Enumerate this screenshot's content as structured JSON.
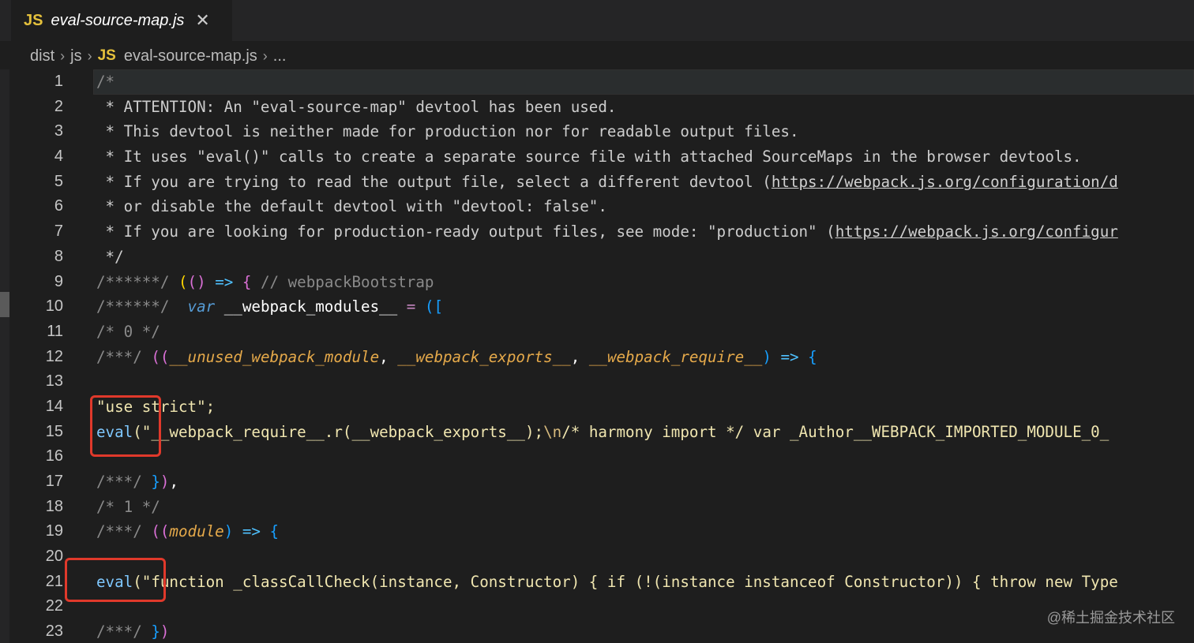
{
  "tab": {
    "badge": "JS",
    "title": "eval-source-map.js",
    "close": "✕"
  },
  "breadcrumb": {
    "items": [
      "dist",
      "js"
    ],
    "badge": "JS",
    "file": "eval-source-map.js",
    "tail": "..."
  },
  "line_numbers": [
    "1",
    "2",
    "3",
    "4",
    "5",
    "6",
    "7",
    "8",
    "9",
    "10",
    "11",
    "12",
    "13",
    "14",
    "15",
    "16",
    "17",
    "18",
    "19",
    "20",
    "21",
    "22",
    "23"
  ],
  "code": {
    "l1": "/*",
    "l2": " * ATTENTION: An \"eval-source-map\" devtool has been used.",
    "l3": " * This devtool is neither made for production nor for readable output files.",
    "l4": " * It uses \"eval()\" calls to create a separate source file with attached SourceMaps in the browser devtools.",
    "l5_a": " * If you are trying to read the output file, select a different devtool (",
    "l5_link": "https://webpack.js.org/configuration/d",
    "l6": " * or disable the default devtool with \"devtool: false\".",
    "l7_a": " * If you are looking for production-ready output files, see mode: \"production\" (",
    "l7_link": "https://webpack.js.org/configur",
    "l8": " */",
    "l9_comment": "/******/ ",
    "l9_p1": "(",
    "l9_p2": "()",
    "l9_arrow": " => ",
    "l9_brace": "{",
    "l9_tail": " // webpackBootstrap",
    "l10_comment": "/******/ ",
    "l10_kw": " var",
    "l10_name": " __webpack_modules__ ",
    "l10_eq": "=",
    "l10_bracket": " ([",
    "l11": "/* 0 */",
    "l12_comment": "/***/ ",
    "l12_p": "((",
    "l12_a1": "__unused_webpack_module",
    "l12_c1": ", ",
    "l12_a2": "__webpack_exports__",
    "l12_c2": ", ",
    "l12_a3": "__webpack_require__",
    "l12_close": ")",
    "l12_arrow": " => ",
    "l12_brace": "{",
    "l14": "\"use strict\";",
    "l15_eval": "eval",
    "l15_a": "(\"__webpack_require__.r(__webpack_exports__);",
    "l15_esc": "\\n",
    "l15_b": "/* harmony import */ var _Author__WEBPACK_IMPORTED_MODULE_0_",
    "l17_comment": "/***/ ",
    "l17_brace": "}",
    "l17_paren": ")",
    "l17_comma": ",",
    "l18": "/* 1 */",
    "l19_comment": "/***/ ",
    "l19_p": "((",
    "l19_arg": "module",
    "l19_close": ")",
    "l19_arrow": " => ",
    "l19_brace": "{",
    "l21_eval": "eval",
    "l21_a": "(\"function _classCallCheck(instance, Constructor) { if (!(instance instanceof Constructor)) { throw new Type",
    "l23_comment": "/***/ ",
    "l23_brace": "}",
    "l23_paren": ")"
  },
  "watermark": "@稀土掘金技术社区"
}
